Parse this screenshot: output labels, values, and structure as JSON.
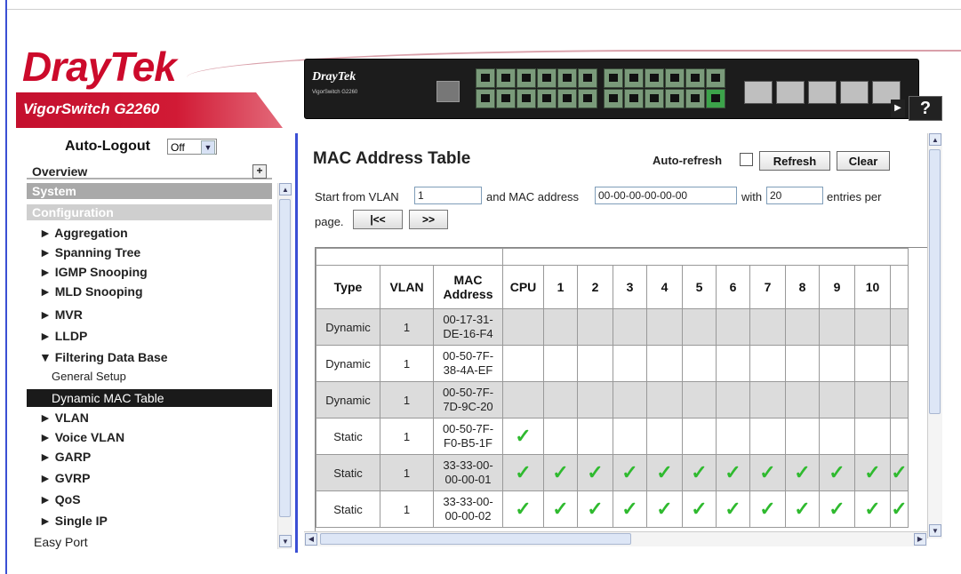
{
  "header": {
    "brand_a": "Dray",
    "brand_b": "Tek",
    "model": "VigorSwitch G2260",
    "device_logo": "DrayTek",
    "device_sub": "VigorSwitch G2260",
    "help_label": "?"
  },
  "sidebar": {
    "autologout_label": "Auto-Logout",
    "autologout_value": "Off",
    "overview": "Overview",
    "system": "System",
    "configuration": "Configuration",
    "items": [
      {
        "label": "► Aggregation"
      },
      {
        "label": "► Spanning Tree"
      },
      {
        "label": "► IGMP Snooping"
      },
      {
        "label": "► MLD Snooping"
      },
      {
        "label": "► MVR"
      },
      {
        "label": "► LLDP"
      },
      {
        "label": "▼ Filtering Data Base"
      }
    ],
    "sub_general": "General Setup",
    "sub_active": "Dynamic MAC Table",
    "items2": [
      {
        "label": "► VLAN"
      },
      {
        "label": "► Voice VLAN"
      },
      {
        "label": "► GARP"
      },
      {
        "label": "► GVRP"
      },
      {
        "label": "► QoS"
      },
      {
        "label": "► Single IP"
      }
    ],
    "easy_port": "Easy Port"
  },
  "main": {
    "title": "MAC Address Table",
    "autorefresh_label": "Auto-refresh",
    "refresh_label": "Refresh",
    "clear_label": "Clear",
    "start_vlan_label": "Start from VLAN",
    "start_vlan_value": "1",
    "mac_label": "and MAC address",
    "mac_value": "00-00-00-00-00-00",
    "with_label": "with",
    "entries_value": "20",
    "entries_label": "entries per",
    "page_label": "page.",
    "first_btn": "|<<",
    "next_btn": ">>"
  },
  "table": {
    "headers": [
      "Type",
      "VLAN",
      "MAC Address",
      "CPU",
      "1",
      "2",
      "3",
      "4",
      "5",
      "6",
      "7",
      "8",
      "9",
      "10"
    ],
    "rows": [
      {
        "type": "Dynamic",
        "vlan": "1",
        "mac": "00-17-31-DE-16-F4",
        "mac_a": "00-17-31-",
        "mac_b": "DE-16-F4",
        "checks": []
      },
      {
        "type": "Dynamic",
        "vlan": "1",
        "mac": "00-50-7F-38-4A-EF",
        "mac_a": "00-50-7F-",
        "mac_b": "38-4A-EF",
        "checks": []
      },
      {
        "type": "Dynamic",
        "vlan": "1",
        "mac": "00-50-7F-7D-9C-20",
        "mac_a": "00-50-7F-",
        "mac_b": "7D-9C-20",
        "checks": []
      },
      {
        "type": "Static",
        "vlan": "1",
        "mac": "00-50-7F-F0-B5-1F",
        "mac_a": "00-50-7F-",
        "mac_b": "F0-B5-1F",
        "checks": [
          "CPU"
        ]
      },
      {
        "type": "Static",
        "vlan": "1",
        "mac": "33-33-00-00-00-01",
        "mac_a": "33-33-00-",
        "mac_b": "00-00-01",
        "checks": [
          "CPU",
          "1",
          "2",
          "3",
          "4",
          "5",
          "6",
          "7",
          "8",
          "9",
          "10"
        ]
      },
      {
        "type": "Static",
        "vlan": "1",
        "mac": "33-33-00-00-00-02",
        "mac_a": "33-33-00-",
        "mac_b": "00-00-02",
        "checks": [
          "CPU",
          "1",
          "2",
          "3",
          "4",
          "5",
          "6",
          "7",
          "8",
          "9",
          "10"
        ]
      }
    ],
    "check_glyph": "✓"
  }
}
